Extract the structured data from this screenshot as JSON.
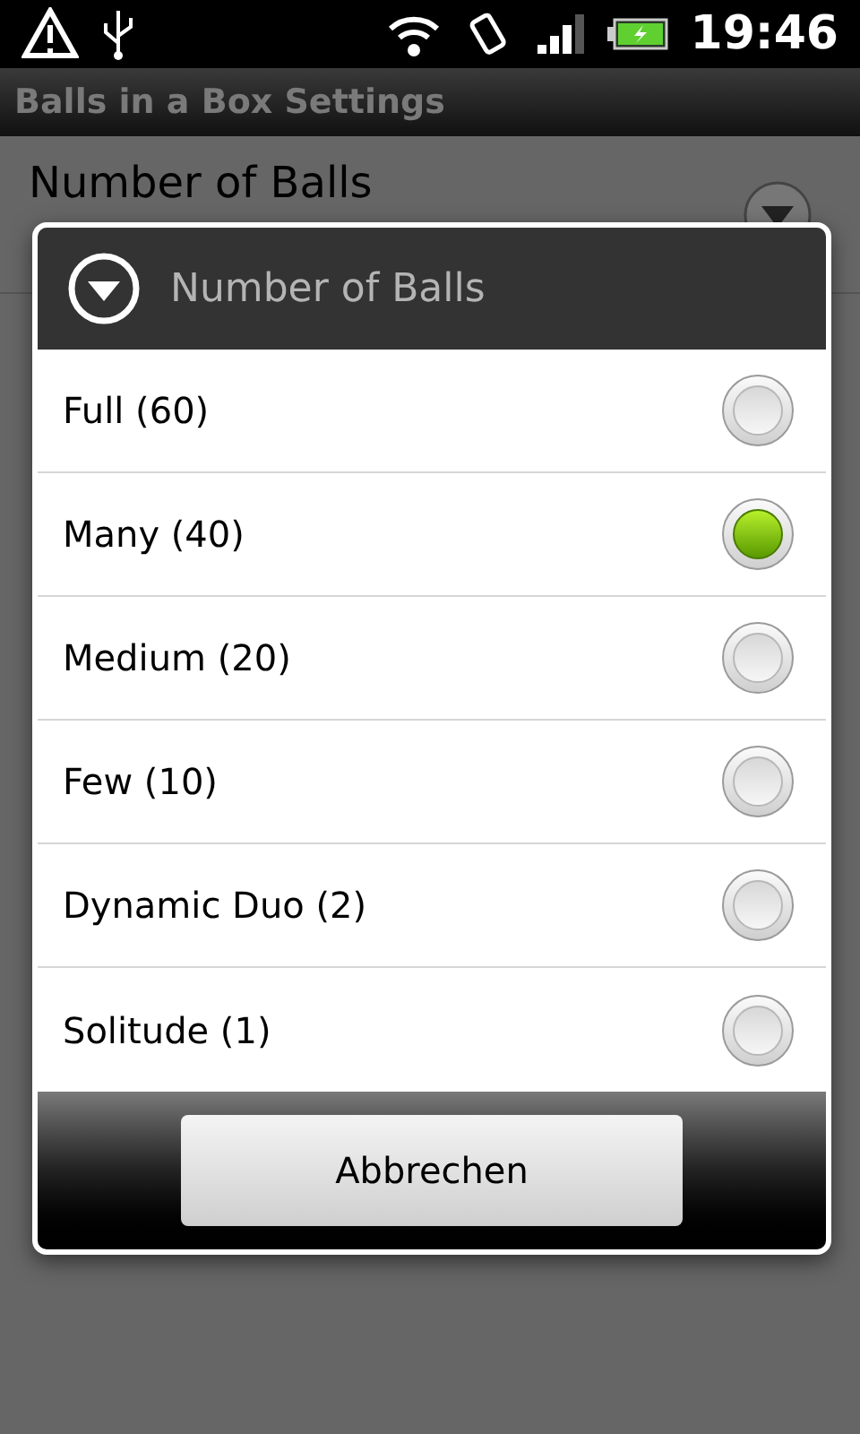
{
  "status_bar": {
    "time": "19:46"
  },
  "title_bar": {
    "title": "Balls in a Box Settings"
  },
  "preference": {
    "title": "Number of Balls"
  },
  "dialog": {
    "title": "Number of Balls",
    "options": [
      {
        "label": "Full (60)",
        "selected": false
      },
      {
        "label": "Many (40)",
        "selected": true
      },
      {
        "label": "Medium (20)",
        "selected": false
      },
      {
        "label": "Few (10)",
        "selected": false
      },
      {
        "label": "Dynamic Duo (2)",
        "selected": false
      },
      {
        "label": "Solitude (1)",
        "selected": false
      }
    ],
    "cancel_button": "Abbrechen"
  }
}
